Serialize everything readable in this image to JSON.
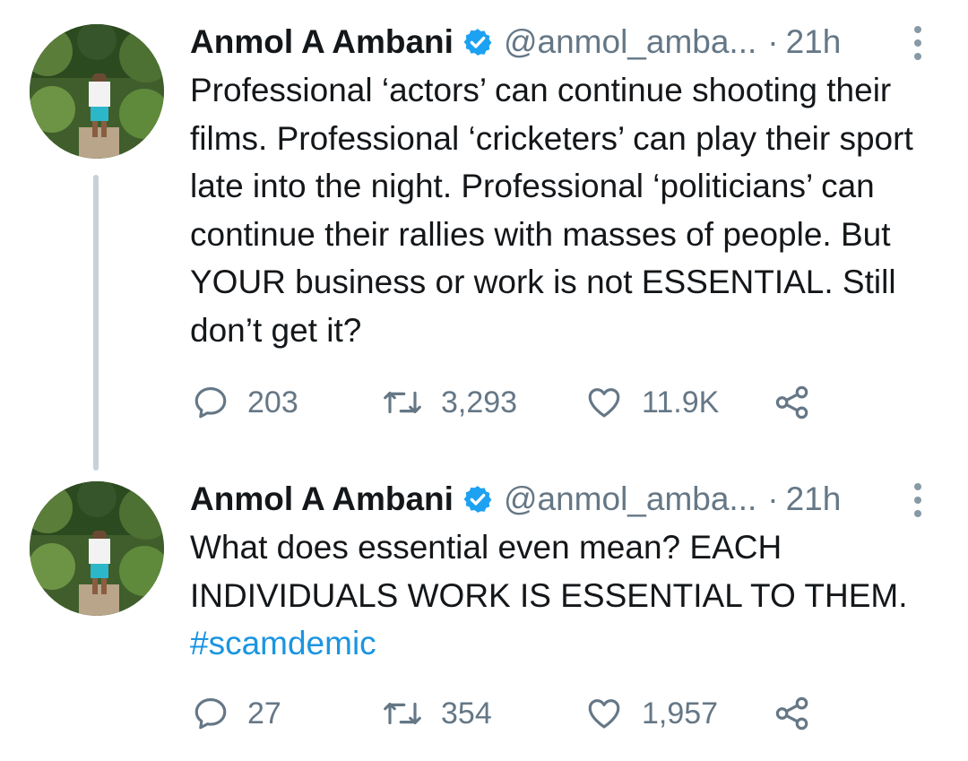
{
  "tweets": [
    {
      "author": {
        "name": "Anmol A Ambani",
        "handle": "@anmol_amba...",
        "verified": true,
        "avatar_icon": "profile-photo"
      },
      "separator": "·",
      "time": "21h",
      "text": "Professional ‘actors’ can continue shooting their films. Professional ‘cricketers’ can play their sport late into the night. Professional ‘politicians’ can continue their rallies with masses of people. But YOUR business or work is not ESSENTIAL.  Still don’t get it?",
      "hashtag": "",
      "stats": {
        "replies": "203",
        "retweets": "3,293",
        "likes": "11.9K"
      }
    },
    {
      "author": {
        "name": "Anmol A Ambani",
        "handle": "@anmol_amba...",
        "verified": true,
        "avatar_icon": "profile-photo"
      },
      "separator": "·",
      "time": "21h",
      "text": "What does essential even mean? EACH INDIVIDUALS WORK IS ESSENTIAL TO THEM.",
      "hashtag": "#scamdemic",
      "stats": {
        "replies": "27",
        "retweets": "354",
        "likes": "1,957"
      }
    }
  ],
  "colors": {
    "text": "#14171a",
    "secondary": "#657786",
    "verified_badge": "#1da1f2",
    "hashtag": "#1b95e0",
    "thread_line": "#c9d1d8"
  },
  "icons": {
    "reply": "reply-icon",
    "retweet": "retweet-icon",
    "like": "like-icon",
    "share": "share-icon",
    "more": "more-icon",
    "verified": "verified-badge-icon"
  }
}
